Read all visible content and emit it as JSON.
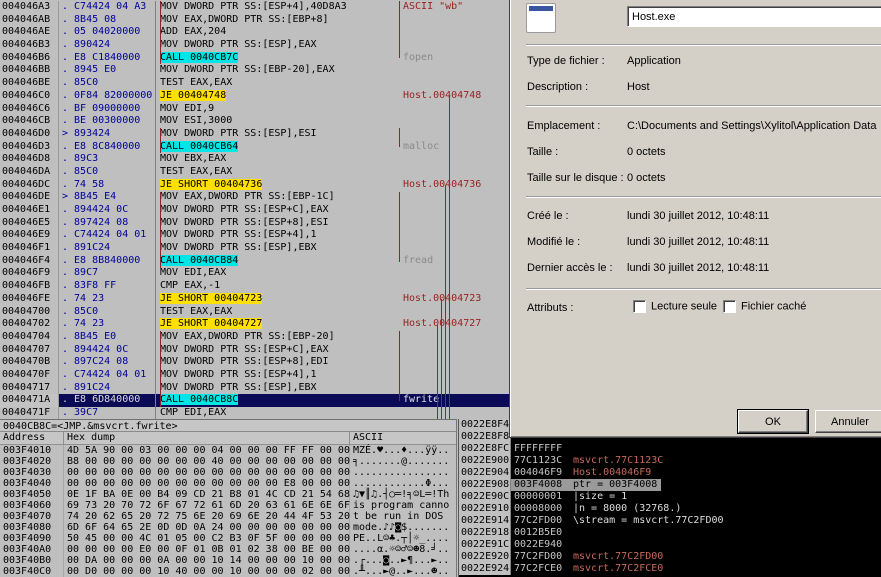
{
  "colors": {
    "pane_bg": "#c0c0c0",
    "selection_row": "#0a0a56",
    "jump_highlight": "#ffe000",
    "call_highlight": "#00e5e5",
    "comment_red": "#9b1f1f",
    "lib_label_gray": "#8a8a8a",
    "hex_bytes_blue": "#00009a",
    "stack_bg": "#000000",
    "dialog_bg": "#d4d0c8"
  },
  "debugger": {
    "info_line": "0040CB8C=<JMP.&msvcrt.fwrite>",
    "disasm_rows": [
      {
        "a": "004046A3",
        "x": ". C74424 04 A3",
        "i": "MOV DWORD PTR SS:[ESP+4],40D8A3",
        "c": "ASCII \"wb\"",
        "ct": "str"
      },
      {
        "a": "004046AB",
        "x": ". 8B45 08",
        "i": "MOV EAX,DWORD PTR SS:[EBP+8]"
      },
      {
        "a": "004046AE",
        "x": ". 05 04020000",
        "i": "ADD EAX,204"
      },
      {
        "a": "004046B3",
        "x": ". 890424",
        "i": "MOV DWORD PTR SS:[ESP],EAX"
      },
      {
        "a": "004046B6",
        "x": ". E8 C1840000",
        "i": "CALL 0040CB7C",
        "hl": "call",
        "c": "fopen",
        "ct": "lib"
      },
      {
        "a": "004046BB",
        "x": ". 8945 E0",
        "i": "MOV DWORD PTR SS:[EBP-20],EAX"
      },
      {
        "a": "004046BE",
        "x": ". 85C0",
        "i": "TEST EAX,EAX"
      },
      {
        "a": "004046C0",
        "x": ". 0F84 82000000",
        "i": "JE 00404748",
        "hl": "jump",
        "c": "Host.00404748",
        "ct": "tgt"
      },
      {
        "a": "004046C6",
        "x": ". BF 09000000",
        "i": "MOV EDI,9"
      },
      {
        "a": "004046CB",
        "x": ". BE 00300000",
        "i": "MOV ESI,3000"
      },
      {
        "a": "004046D0",
        "x": "> 893424",
        "i": "MOV DWORD PTR SS:[ESP],ESI"
      },
      {
        "a": "004046D3",
        "x": ". E8 8C840000",
        "i": "CALL 0040CB64",
        "hl": "call",
        "c": "malloc",
        "ct": "lib"
      },
      {
        "a": "004046D8",
        "x": ". 89C3",
        "i": "MOV EBX,EAX"
      },
      {
        "a": "004046DA",
        "x": ". 85C0",
        "i": "TEST EAX,EAX"
      },
      {
        "a": "004046DC",
        "x": ". 74 58",
        "i": "JE SHORT 00404736",
        "hl": "jump",
        "c": "Host.00404736",
        "ct": "tgt"
      },
      {
        "a": "004046DE",
        "x": "> 8B45 E4",
        "i": "MOV EAX,DWORD PTR SS:[EBP-1C]"
      },
      {
        "a": "004046E1",
        "x": ". 894424 0C",
        "i": "MOV DWORD PTR SS:[ESP+C],EAX"
      },
      {
        "a": "004046E5",
        "x": ". 897424 08",
        "i": "MOV DWORD PTR SS:[ESP+8],ESI"
      },
      {
        "a": "004046E9",
        "x": ". C74424 04 01",
        "i": "MOV DWORD PTR SS:[ESP+4],1"
      },
      {
        "a": "004046F1",
        "x": ". 891C24",
        "i": "MOV DWORD PTR SS:[ESP],EBX"
      },
      {
        "a": "004046F4",
        "x": ". E8 8B840000",
        "i": "CALL 0040CB84",
        "hl": "call",
        "c": "fread",
        "ct": "lib"
      },
      {
        "a": "004046F9",
        "x": ". 89C7",
        "i": "MOV EDI,EAX"
      },
      {
        "a": "004046FB",
        "x": ". 83F8 FF",
        "i": "CMP EAX,-1"
      },
      {
        "a": "004046FE",
        "x": ". 74 23",
        "i": "JE SHORT 00404723",
        "hl": "jump",
        "c": "Host.00404723",
        "ct": "tgt"
      },
      {
        "a": "00404700",
        "x": ". 85C0",
        "i": "TEST EAX,EAX"
      },
      {
        "a": "00404702",
        "x": ". 74 23",
        "i": "JE SHORT 00404727",
        "hl": "jump",
        "c": "Host.00404727",
        "ct": "tgt"
      },
      {
        "a": "00404704",
        "x": ". 8B45 E0",
        "i": "MOV EAX,DWORD PTR SS:[EBP-20]"
      },
      {
        "a": "00404707",
        "x": ". 894424 0C",
        "i": "MOV DWORD PTR SS:[ESP+C],EAX"
      },
      {
        "a": "0040470B",
        "x": ". 897C24 08",
        "i": "MOV DWORD PTR SS:[ESP+8],EDI"
      },
      {
        "a": "0040470F",
        "x": ". C74424 04 01",
        "i": "MOV DWORD PTR SS:[ESP+4],1"
      },
      {
        "a": "00404717",
        "x": ". 891C24",
        "i": "MOV DWORD PTR SS:[ESP],EBX"
      },
      {
        "a": "0040471A",
        "x": ". E8 6D840000",
        "i": "CALL 0040CB8C",
        "hl": "call",
        "c": "fwrite",
        "ct": "lib",
        "sel": true
      },
      {
        "a": "0040471F",
        "x": ". 39C7",
        "i": "CMP EDI,EAX"
      }
    ],
    "dump": {
      "headers": [
        "Address",
        "Hex dump",
        "ASCII"
      ],
      "rows": [
        {
          "addr": "003F4010",
          "hex": "4D 5A 90 00 03 00 00 00 04 00 00 00 FF FF 00 00",
          "ascii": "MZÉ.♥...♦...ÿÿ.."
        },
        {
          "addr": "003F4020",
          "hex": "B8 00 00 00 00 00 00 00 40 00 00 00 00 00 00 00",
          "ascii": "╕.......@......."
        },
        {
          "addr": "003F4030",
          "hex": "00 00 00 00 00 00 00 00 00 00 00 00 00 00 00 00",
          "ascii": "................"
        },
        {
          "addr": "003F4040",
          "hex": "00 00 00 00 00 00 00 00 00 00 00 00 E8 00 00 00",
          "ascii": "............Φ..."
        },
        {
          "addr": "003F4050",
          "hex": "0E 1F BA 0E 00 B4 09 CD 21 B8 01 4C CD 21 54 68",
          "ascii": "♫▼║♫.┤○═!╕☺L═!Th"
        },
        {
          "addr": "003F4060",
          "hex": "69 73 20 70 72 6F 67 72 61 6D 20 63 61 6E 6E 6F",
          "ascii": "is program canno"
        },
        {
          "addr": "003F4070",
          "hex": "74 20 62 65 20 72 75 6E 20 69 6E 20 44 4F 53 20",
          "ascii": "t be run in DOS "
        },
        {
          "addr": "003F4080",
          "hex": "6D 6F 64 65 2E 0D 0D 0A 24 00 00 00 00 00 00 00",
          "ascii": "mode.♪♪◙$......."
        },
        {
          "addr": "003F4090",
          "hex": "50 45 00 00 4C 01 05 00 C2 B3 0F 5F 00 00 00 00",
          "ascii": "PE..L☺♣.┬│☼_...."
        },
        {
          "addr": "003F40A0",
          "hex": "00 00 00 00 E0 00 0F 01 0B 01 02 38 00 BE 00 00",
          "ascii": "....α.☼☺♂☺☻8.╛.."
        },
        {
          "addr": "003F40B0",
          "hex": "00 DA 00 00 00 0A 00 00 10 14 00 00 00 10 00 00",
          "ascii": ".┌...◙..►¶...►.."
        },
        {
          "addr": "003F40C0",
          "hex": "00 D0 00 00 00 10 40 00 00 10 00 00 00 02 00 00",
          "ascii": ".╨...►@..►...☻.."
        }
      ]
    },
    "stack": {
      "rows": [
        {
          "addr": "0022E8F4",
          "val": "",
          "cmt": ""
        },
        {
          "addr": "0022E8F8",
          "val": "",
          "cmt": ""
        },
        {
          "addr": "0022E8FC",
          "val": "FFFFFFFF",
          "cmt": ""
        },
        {
          "addr": "0022E900",
          "val": "77C1123C",
          "cmt": "msvcrt.77C1123C",
          "ct": "mod"
        },
        {
          "addr": "0022E904",
          "val": "004046F9",
          "cmt": "Host.004046F9",
          "ct": "mod"
        },
        {
          "addr": "0022E908",
          "val": "003F4008",
          "cmt": "ptr = 003F4008",
          "ct": "ann",
          "sel": true
        },
        {
          "addr": "0022E90C",
          "val": "00000001",
          "cmt": "|size = 1",
          "ct": "ann"
        },
        {
          "addr": "0022E910",
          "val": "00008000",
          "cmt": "|n = 8000 (32768.)",
          "ct": "ann"
        },
        {
          "addr": "0022E914",
          "val": "77C2FD00",
          "cmt": "\\stream = msvcrt.77C2FD00",
          "ct": "ann"
        },
        {
          "addr": "0022E918",
          "val": "0012B5E0",
          "cmt": ""
        },
        {
          "addr": "0022E91C",
          "val": "0022E940",
          "cmt": ""
        },
        {
          "addr": "0022E920",
          "val": "77C2FD00",
          "cmt": "msvcrt.77C2FD00",
          "ct": "mod"
        },
        {
          "addr": "0022E924",
          "val": "77C2FCE0",
          "cmt": "msvcrt.77C2FCE0",
          "ct": "mod"
        }
      ]
    }
  },
  "dialog": {
    "filename": "Host.exe",
    "rows": [
      {
        "label": "Type de fichier :",
        "value": "Application"
      },
      {
        "label": "Description :",
        "value": "Host"
      },
      {
        "sep": true
      },
      {
        "label": "Emplacement :",
        "value": "C:\\Documents and Settings\\Xylitol\\Application Data"
      },
      {
        "label": "Taille :",
        "value": "0 octets"
      },
      {
        "label": "Taille sur le disque :",
        "value": "0 octets"
      },
      {
        "sep": true
      },
      {
        "label": "Créé le :",
        "value": "lundi 30 juillet 2012, 10:48:11"
      },
      {
        "label": "Modifié le :",
        "value": "lundi 30 juillet 2012, 10:48:11"
      },
      {
        "label": "Dernier accès le :",
        "value": "lundi 30 juillet 2012, 10:48:11"
      },
      {
        "sep": true
      }
    ],
    "attributes_label": "Attributs :",
    "checkboxes": [
      {
        "label": "Lecture seule",
        "checked": false
      },
      {
        "label": "Fichier caché",
        "checked": false
      }
    ],
    "buttons": {
      "ok": "OK",
      "cancel": "Annuler"
    }
  }
}
